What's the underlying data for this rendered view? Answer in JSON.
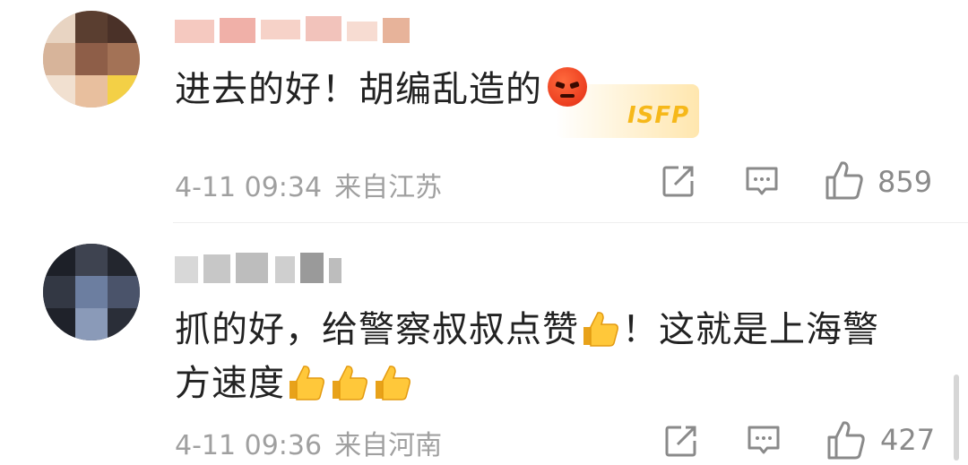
{
  "comments": [
    {
      "text": "进去的好！胡编乱造的",
      "emoji": "angry-face-icon",
      "badge_text": "ISFP",
      "date": "4-11 09:34",
      "location": "来自江苏",
      "likes": "859"
    },
    {
      "text_line1": "抓的好，给警察叔叔点赞",
      "text_line1_after": "！这就是上海警",
      "text_line2": "方速度",
      "emoji": "thumbs-up-icon",
      "date": "4-11 09:36",
      "location": "来自河南",
      "likes": "427"
    }
  ],
  "colors": {
    "text": "#222222",
    "meta": "#a0a0a0",
    "icon": "#8a8a8a",
    "divider": "#eeeeee"
  }
}
